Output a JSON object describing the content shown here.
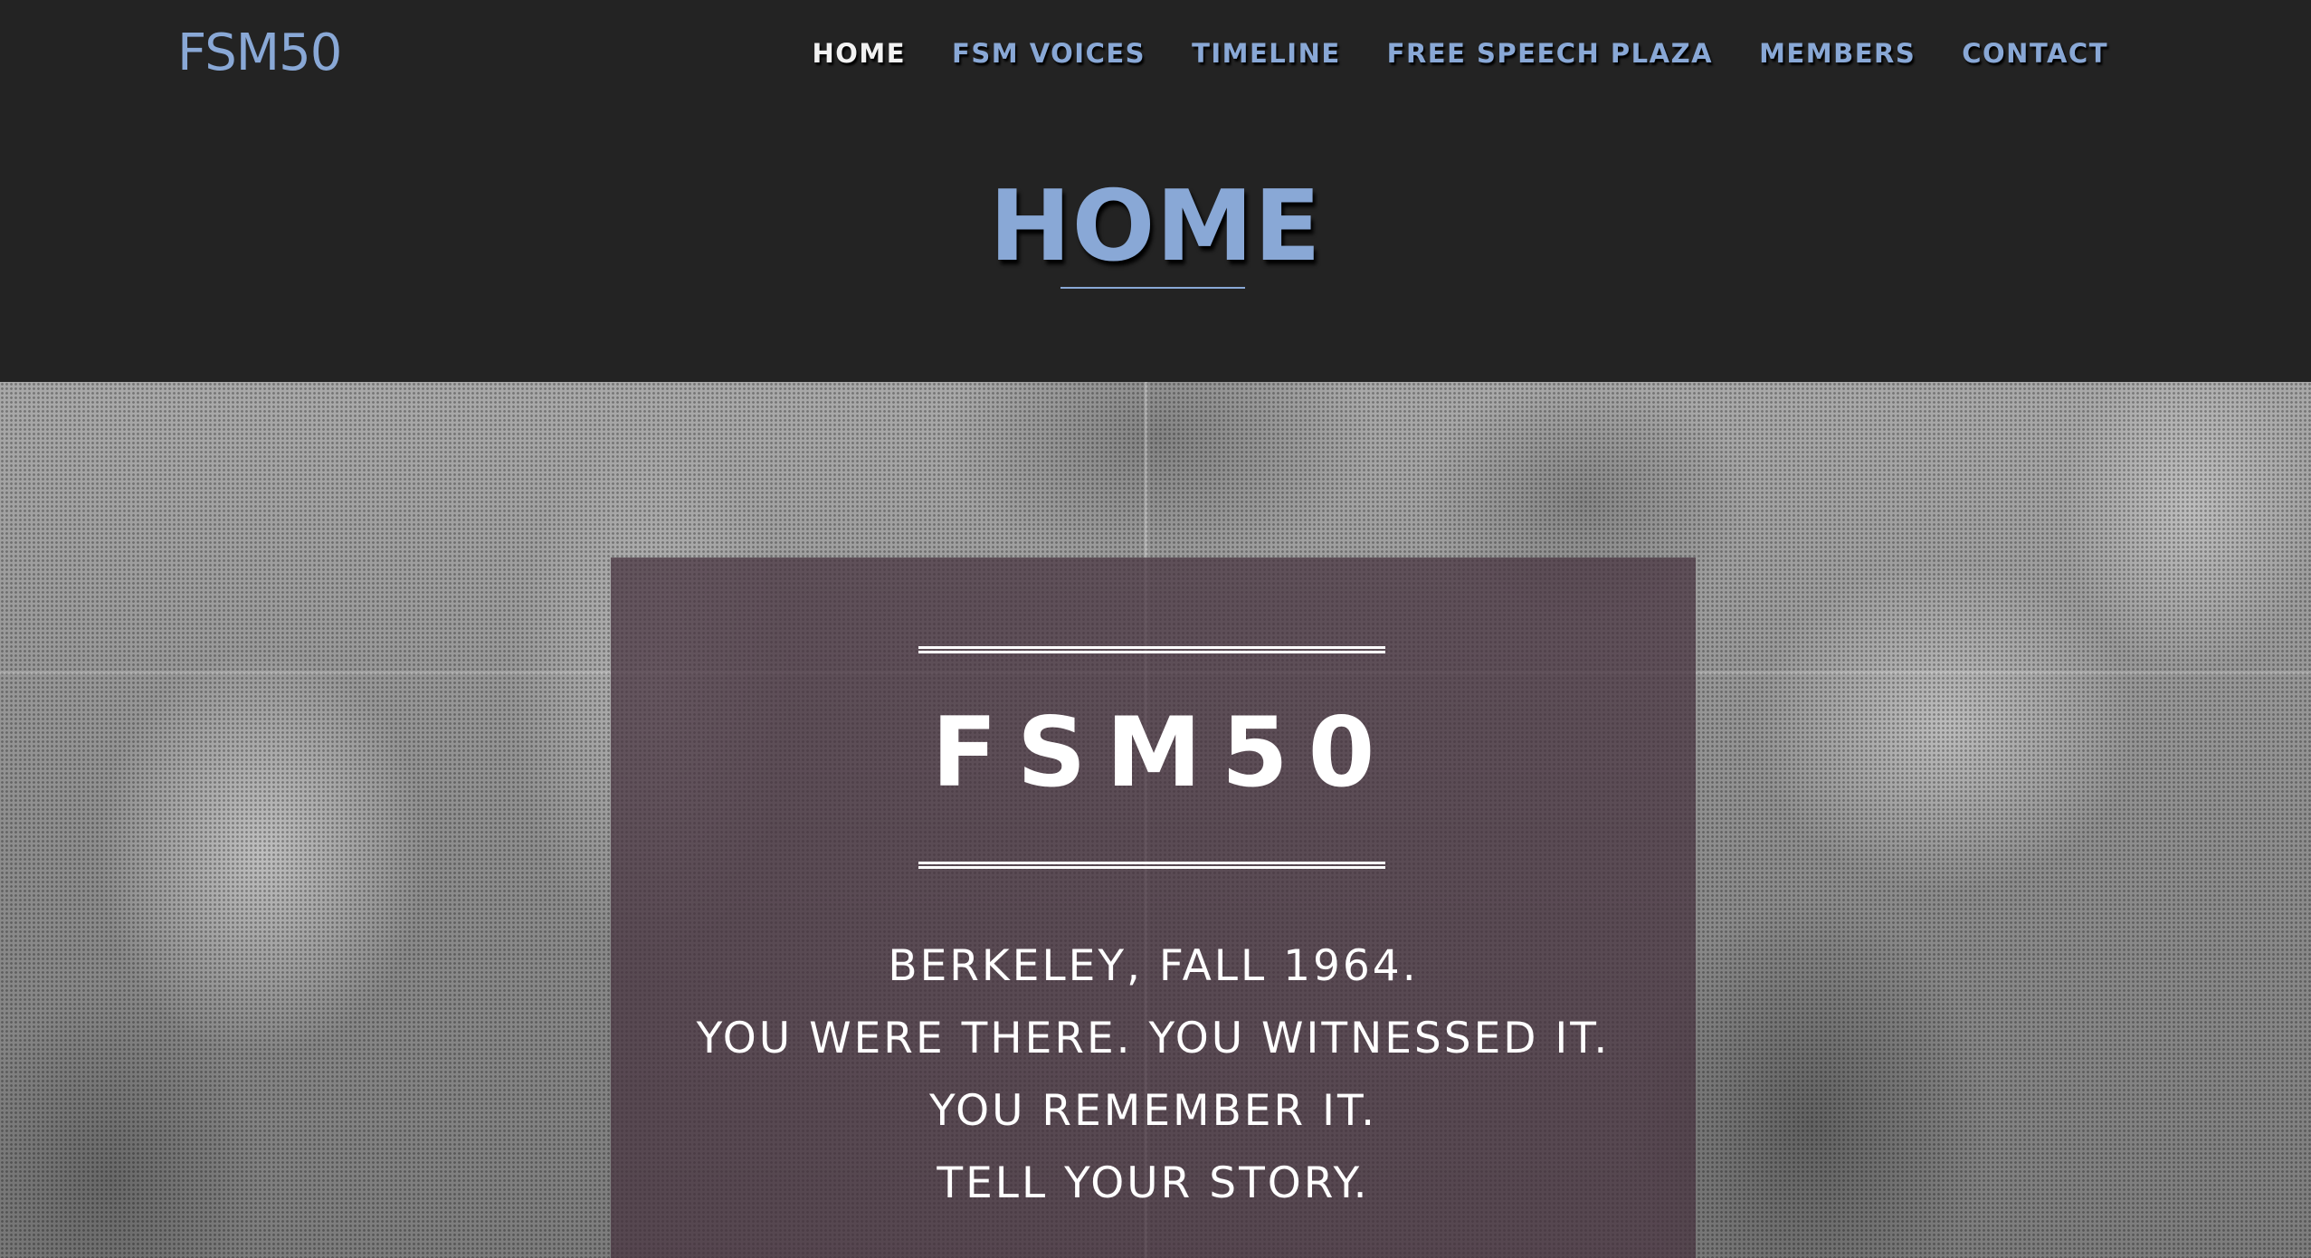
{
  "brand": {
    "logo_text": "FSM50"
  },
  "nav": {
    "items": [
      {
        "label": "HOME",
        "active": true
      },
      {
        "label": "FSM VOICES",
        "active": false
      },
      {
        "label": "TIMELINE",
        "active": false
      },
      {
        "label": "FREE SPEECH PLAZA",
        "active": false
      },
      {
        "label": "MEMBERS",
        "active": false
      },
      {
        "label": "CONTACT",
        "active": false
      }
    ]
  },
  "page": {
    "title": "HOME"
  },
  "hero": {
    "title": "FSM50",
    "lines": [
      "BERKELEY, FALL 1964.",
      "YOU WERE THERE. YOU WITNESSED IT.",
      "YOU REMEMBER IT.",
      "TELL YOUR STORY."
    ]
  },
  "colors": {
    "header_background": "#232323",
    "accent_blue": "#89a8d6",
    "nav_active": "#f2f2f2",
    "panel_overlay": "#46323e",
    "hero_text": "#ffffff"
  }
}
